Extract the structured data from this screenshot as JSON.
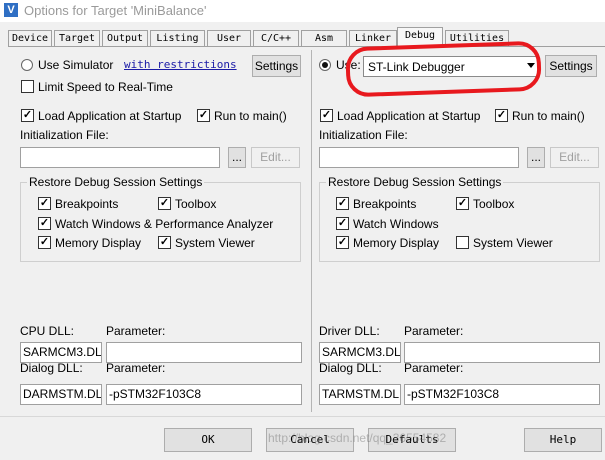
{
  "window": {
    "title": "Options for Target 'MiniBalance'",
    "icon_label": "V"
  },
  "tabs": [
    {
      "label": "Device"
    },
    {
      "label": "Target"
    },
    {
      "label": "Output"
    },
    {
      "label": "Listing"
    },
    {
      "label": "User"
    },
    {
      "label": "C/C++"
    },
    {
      "label": "Asm"
    },
    {
      "label": "Linker"
    },
    {
      "label": "Debug",
      "active": true
    },
    {
      "label": "Utilities"
    }
  ],
  "left": {
    "use_simulator": "Use Simulator",
    "with_restrictions": "with restrictions",
    "settings": "Settings",
    "limit_speed": "Limit Speed to Real-Time",
    "load_app": "Load Application at Startup",
    "run_to_main": "Run to main()",
    "init_file_label": "Initialization File:",
    "init_file_value": "",
    "browse": "...",
    "edit": "Edit...",
    "restore_group": "Restore Debug Session Settings",
    "breakpoints": "Breakpoints",
    "toolbox": "Toolbox",
    "watch": "Watch Windows & Performance Analyzer",
    "memory": "Memory Display",
    "system_viewer": "System Viewer",
    "dll_label": "CPU DLL:",
    "param_label": "Parameter:",
    "dll_value": "SARMCM3.DLL",
    "dll_param": "",
    "dialog_label": "Dialog DLL:",
    "dialog_param_label": "Parameter:",
    "dialog_value": "DARMSTM.DLL",
    "dialog_param": "-pSTM32F103C8"
  },
  "right": {
    "use": "Use:",
    "debugger": "ST-Link Debugger",
    "settings": "Settings",
    "load_app": "Load Application at Startup",
    "run_to_main": "Run to main()",
    "init_file_label": "Initialization File:",
    "init_file_value": "",
    "browse": "...",
    "edit": "Edit...",
    "restore_group": "Restore Debug Session Settings",
    "breakpoints": "Breakpoints",
    "toolbox": "Toolbox",
    "watch": "Watch Windows",
    "memory": "Memory Display",
    "system_viewer": "System Viewer",
    "dll_label": "Driver DLL:",
    "param_label": "Parameter:",
    "dll_value": "SARMCM3.DLL",
    "dll_param": "",
    "dialog_label": "Dialog DLL:",
    "dialog_param_label": "Parameter:",
    "dialog_value": "TARMSTM.DLL",
    "dialog_param": "-pSTM32F103C8"
  },
  "checks": {
    "left": {
      "use_simulator": false,
      "limit_speed": false,
      "load_app": true,
      "run_to_main": true,
      "breakpoints": true,
      "toolbox": true,
      "watch": true,
      "memory": true,
      "system_viewer": true
    },
    "right": {
      "use": true,
      "load_app": true,
      "run_to_main": true,
      "breakpoints": true,
      "toolbox": true,
      "watch": true,
      "memory": true,
      "system_viewer": false
    }
  },
  "footer": {
    "ok": "OK",
    "cancel": "Cancel",
    "defaults": "Defaults",
    "help": "Help"
  },
  "watermark": "http://blog.csdn.net/qq_36554582",
  "colors": {
    "highlight": "#e8191e",
    "title_icon": "#2f6fc4"
  }
}
